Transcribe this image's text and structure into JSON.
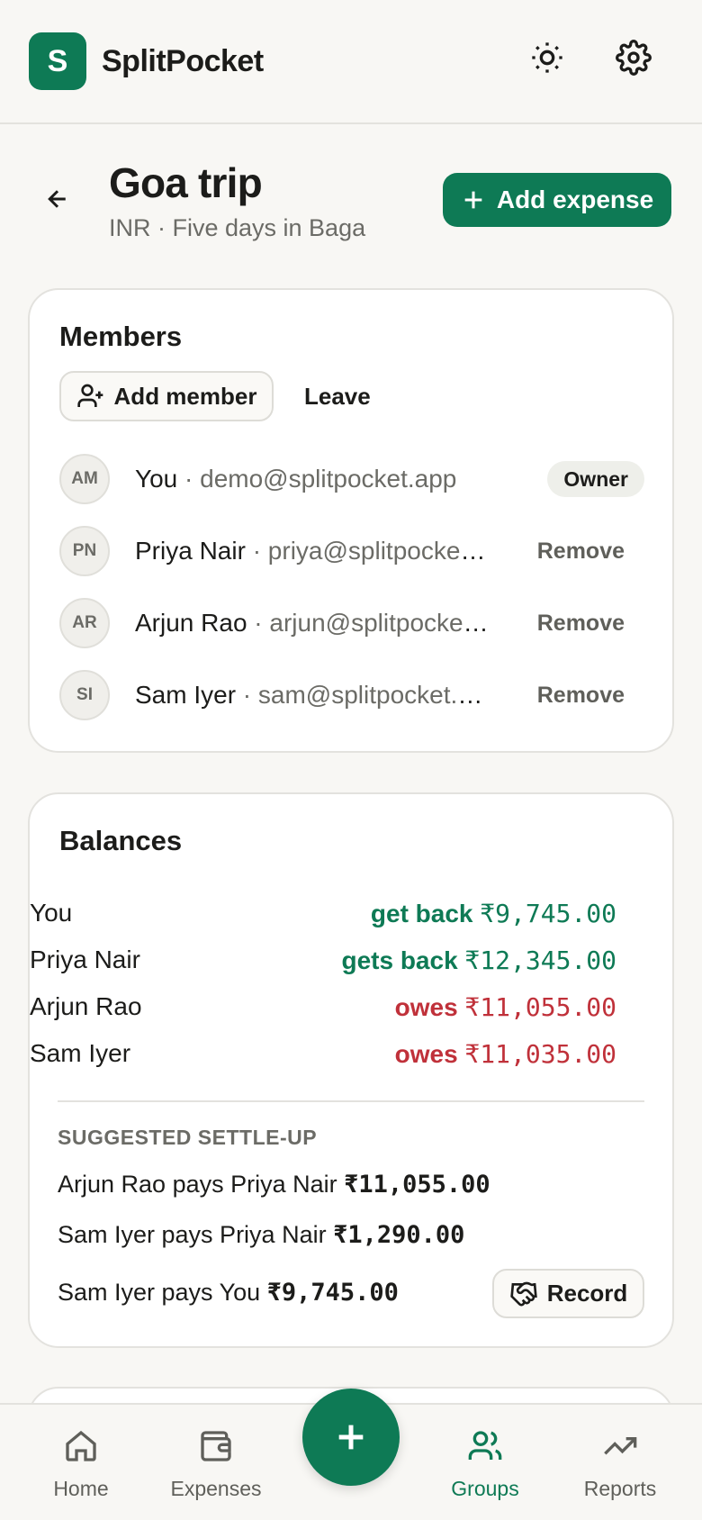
{
  "app": {
    "logo_letter": "S",
    "name": "SplitPocket"
  },
  "header_icons": {
    "theme": "sun-icon",
    "settings": "gear-icon"
  },
  "group": {
    "title": "Goa trip",
    "subtitle": "INR · Five days in Baga",
    "add_expense_label": "Add expense"
  },
  "members": {
    "title": "Members",
    "add_member_label": "Add member",
    "leave_label": "Leave",
    "list": [
      {
        "initials": "AM",
        "name": "You",
        "email": " · demo@splitpocket.app",
        "action": "Owner"
      },
      {
        "initials": "PN",
        "name": "Priya Nair",
        "email": " · priya@splitpocket.app",
        "action": "Remove"
      },
      {
        "initials": "AR",
        "name": "Arjun Rao",
        "email": " · arjun@splitpocket.app",
        "action": "Remove"
      },
      {
        "initials": "SI",
        "name": "Sam Iyer",
        "email": " · sam@splitpocket.app",
        "action": "Remove"
      }
    ]
  },
  "balances": {
    "title": "Balances",
    "rows": [
      {
        "name": "You",
        "verb": "get back ",
        "amount": "₹9,745.00",
        "status_color": "#0e7a55"
      },
      {
        "name": "Priya Nair",
        "verb": "gets back ",
        "amount": "₹12,345.00",
        "status_color": "#0e7a55"
      },
      {
        "name": "Arjun Rao",
        "verb": "owes ",
        "amount": "₹11,055.00",
        "status_color": "#c0313a"
      },
      {
        "name": "Sam Iyer",
        "verb": "owes ",
        "amount": "₹11,035.00",
        "status_color": "#c0313a"
      }
    ],
    "settle_heading": "SUGGESTED SETTLE-UP",
    "settle": [
      {
        "text": "Arjun Rao pays Priya Nair ",
        "amount": "₹11,055.00"
      },
      {
        "text": "Sam Iyer pays Priya Nair ",
        "amount": "₹1,290.00"
      },
      {
        "text": "Sam Iyer pays You ",
        "amount": "₹9,745.00"
      }
    ],
    "record_label": "Record"
  },
  "nav": {
    "items": [
      {
        "label": "Home",
        "icon": "home-icon"
      },
      {
        "label": "Expenses",
        "icon": "wallet-icon"
      },
      {
        "label": "Groups",
        "icon": "users-icon",
        "active": true
      },
      {
        "label": "Reports",
        "icon": "trending-up-icon"
      }
    ],
    "fab_icon": "plus-icon"
  },
  "colors": {
    "brand": "#0e7a55",
    "negative": "#c0313a",
    "background": "#f8f7f4"
  }
}
